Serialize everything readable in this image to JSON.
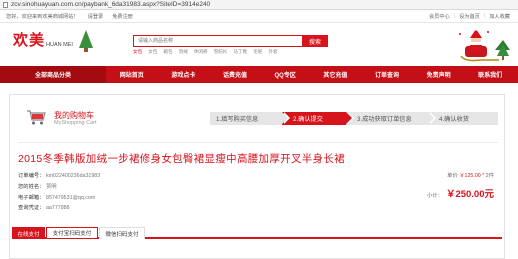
{
  "browser": {
    "url": "zcv.sinohuayuan.com.cn/paybank_6da31983.aspx?SiteID=3914e240"
  },
  "topbar": {
    "welcome": "您好，欢迎来到欢美商城网站！",
    "login": "请登录",
    "register": "免费注册",
    "member_center": "会员中心",
    "set_home": "设为首页",
    "add_favorite": "加入收藏"
  },
  "header": {
    "logo_cn": "欢美",
    "logo_en": "HUAN MEI",
    "search_placeholder": "请输入商品名称",
    "search_button": "搜索",
    "hotwords": [
      "女包",
      "女包",
      "箱包",
      "羽绒",
      "休闲裤",
      "雪纺衫",
      "马丁靴",
      "毛呢",
      "外套"
    ]
  },
  "nav": {
    "all_categories": "全部商品分类",
    "items": [
      "网站首页",
      "游戏点卡",
      "话费充值",
      "QQ专区",
      "其它充值",
      "订单查询",
      "免责声明",
      "联系我们"
    ]
  },
  "cart": {
    "title": "我的购物车",
    "subtitle": "MyShopping Cart",
    "steps": [
      "1.填写购买信息",
      "2.确认提交",
      "3.成功获取订单信息",
      "4.确认收货"
    ],
    "active_step": 2
  },
  "order": {
    "product_title": "2015冬季韩版加绒一步裙修身女包臀裙显瘦中高腰加厚开叉半身长裙",
    "fields": [
      {
        "label": "订单编号：",
        "value": "km022400236da31983"
      },
      {
        "label": "您的姓名：",
        "value": "贾明"
      },
      {
        "label": "电子邮箱：",
        "value": "857479531@qq.com"
      },
      {
        "label": "查询凭证：",
        "value": "aa777888"
      }
    ],
    "unit_price_label": "单价",
    "unit_price": "￥125.00",
    "quantity": "* 2件",
    "subtotal_label": "小计：",
    "subtotal": "￥250.00元"
  },
  "payment": {
    "tabs": [
      "在线支付",
      "支付宝扫码支付",
      "微信扫码支付"
    ],
    "active_tab": 0,
    "highlighted_tab": 1
  },
  "colors": {
    "brand_red": "#d7131c",
    "nav_red": "#c40f17"
  }
}
